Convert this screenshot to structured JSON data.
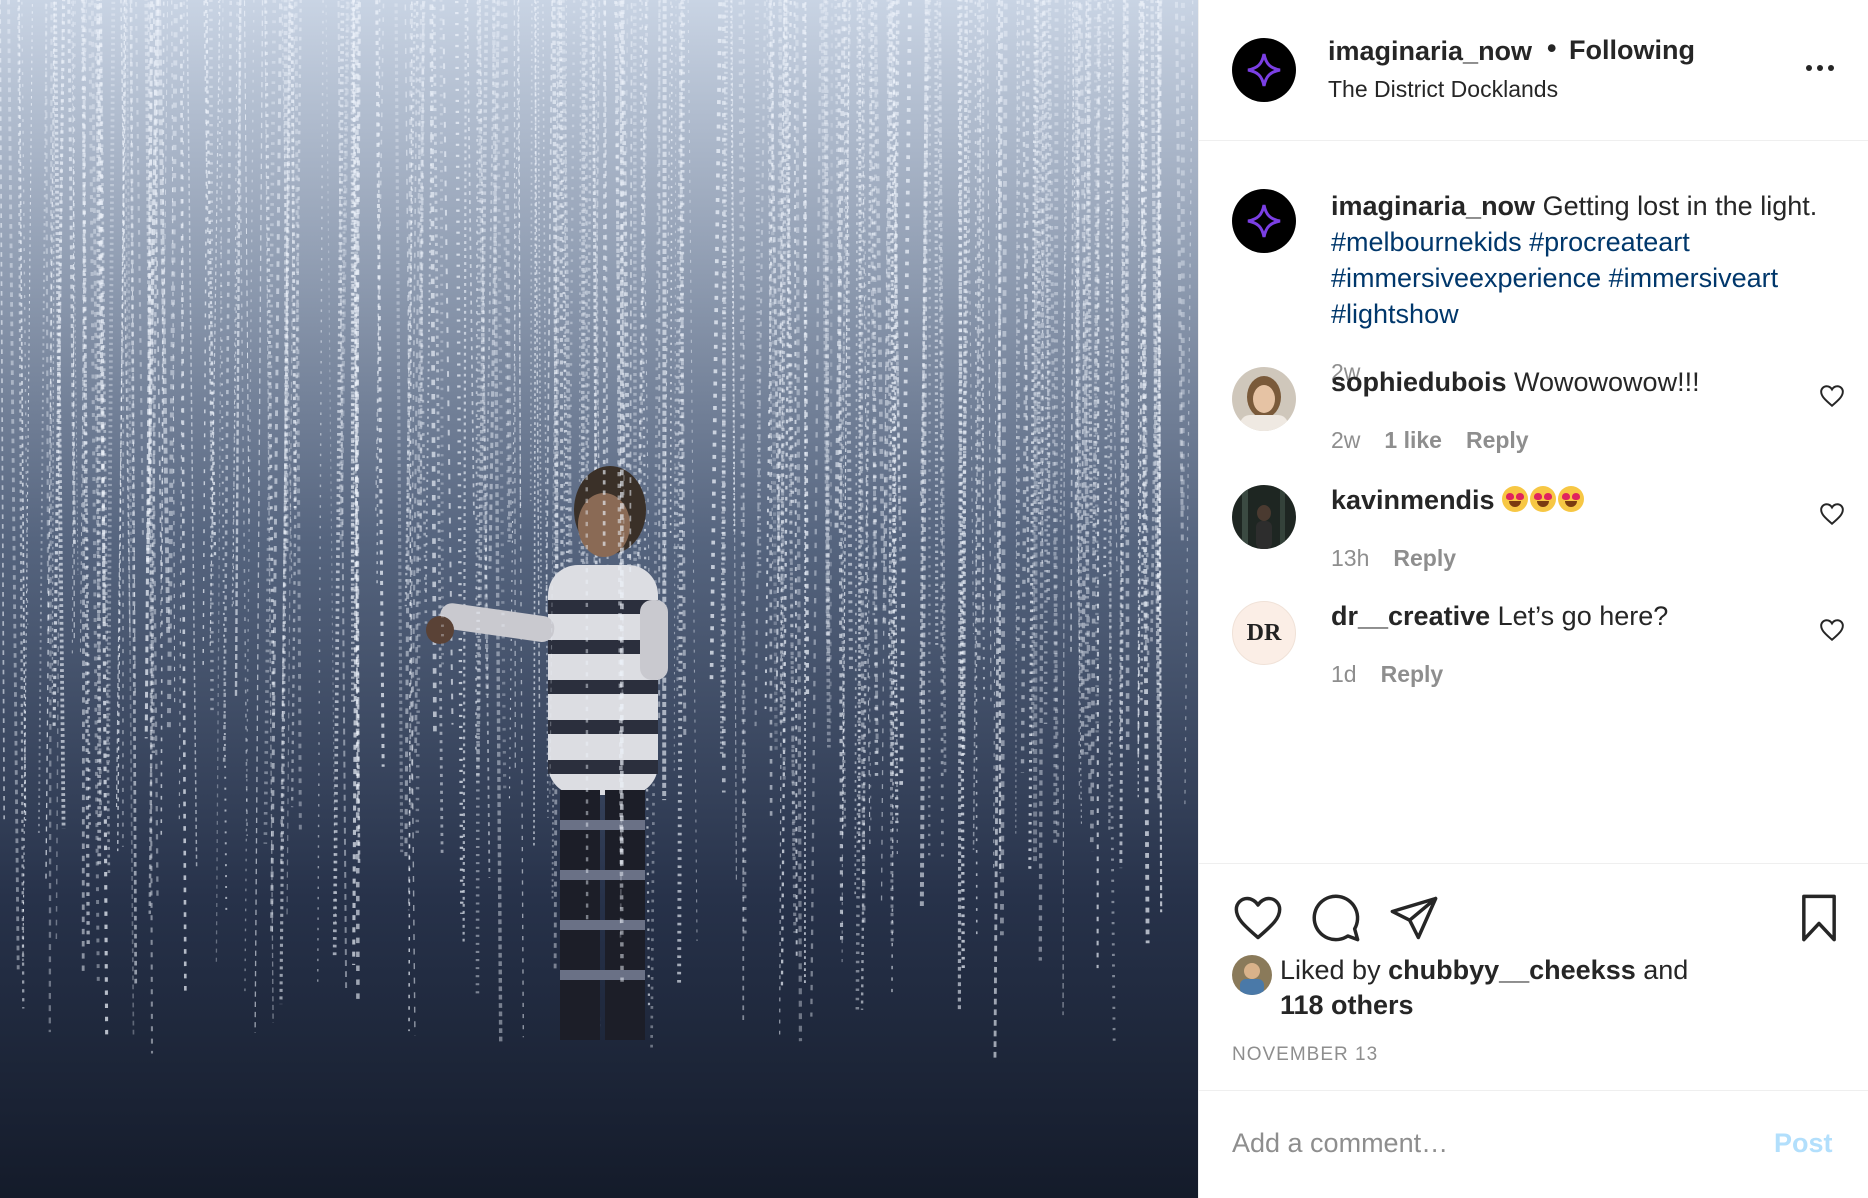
{
  "post": {
    "username": "imaginaria_now",
    "follow_separator": "•",
    "follow_state": "Following",
    "location": "The District Docklands",
    "photo_subject": "child standing among hanging light strands"
  },
  "caption": {
    "username": "imaginaria_now",
    "text": "Getting lost in the light.",
    "hashtags": [
      "#melbournekids",
      "#procreateart",
      "#immersiveexperience",
      "#immersiveart",
      "#lightshow"
    ],
    "time": "2w"
  },
  "comments": [
    {
      "username": "sophiedubois",
      "text": "Wowowowow!!!",
      "time": "2w",
      "likes": "1 like",
      "reply": "Reply"
    },
    {
      "username": "kavinmendis",
      "text": "",
      "emoji_count": 3,
      "time": "13h",
      "reply": "Reply"
    },
    {
      "username": "dr__creative",
      "text": "Let’s go here?",
      "time": "1d",
      "reply": "Reply",
      "avatar_text": "DR"
    }
  ],
  "likes": {
    "prefix": "Liked by",
    "user": "chubbyy__cheekss",
    "connector": "and",
    "others": "118 others"
  },
  "date": "NOVEMBER 13",
  "add_comment": {
    "placeholder": "Add a comment…",
    "post_label": "Post"
  },
  "colors": {
    "hashtag": "#00376b",
    "muted": "#8e8e8e",
    "post_disabled": "#b2dffc",
    "logo_purple": "#7b3fe4"
  },
  "icons": [
    "more-icon",
    "heart-icon",
    "comment-icon",
    "share-icon",
    "bookmark-icon"
  ]
}
